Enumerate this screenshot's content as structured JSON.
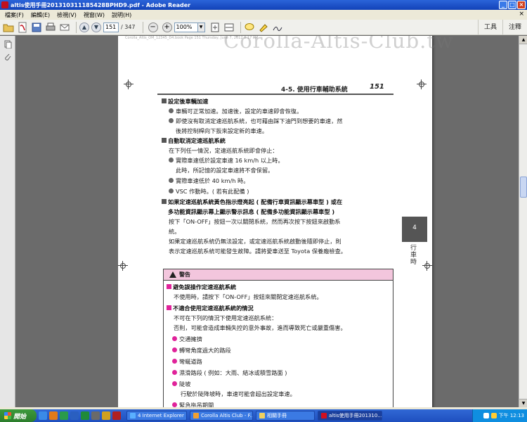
{
  "window": {
    "title": "altis使用手冊201310311185428BPHD9.pdf - Adobe Reader",
    "buttons": [
      "_",
      "□",
      "×"
    ]
  },
  "menu": {
    "items": [
      "檔案(F)",
      "編輯(E)",
      "檢視(V)",
      "視窗(W)",
      "說明(H)"
    ],
    "close": "×"
  },
  "toolbar": {
    "page_current": "151",
    "page_total": "/ 347",
    "zoom": "100%",
    "zoom_out": "−",
    "zoom_in": "+",
    "tools_label": "工具",
    "comment_label": "注釋",
    "prev_arrow": "▲",
    "next_arrow": "▼",
    "dropdown": "▼"
  },
  "scrollbar": {
    "up": "▲",
    "down": "▼"
  },
  "pdf": {
    "watermark": "Corolla-Altis-Club.tw",
    "header_strip": "Corolla_Altis_OM_12345_D4.book  Page 151  Thursday, June 7, 2012  8:17 PM",
    "section_title": "4-5. 使用行車輔助系統",
    "page_number": "151",
    "side_tab_number": "4",
    "side_tab_label": "行車時",
    "s1": {
      "head": "設定後車輛加速",
      "b1": "車輛可正常加速。加速後，設定的車速即會恢復。",
      "b2a": "即使沒有取消定速巡航系統，也可藉由踩下油門到想要的車速，然",
      "b2b": "後將控制桿向下扳來設定新的車速。"
    },
    "s2": {
      "head": "自動取消定速巡航系統",
      "intro": "在下列任一情況，定速巡航系統即會停止：",
      "b1": "實際車速低於設定車速 16 km/h 以上時。",
      "b1b": "此時，所記憶的設定車速將不會保留。",
      "b2": "實際車速低於 40 km/h 時。",
      "b3": "VSC 作動時。( 若有此配備 )"
    },
    "s3": {
      "head1": "如果定速巡航系統黃色指示燈亮起 ( 配備行車資訊顯示幕車型 ) 或在",
      "head2": "多功能資訊顯示幕上顯示警示訊息 ( 配備多功能資訊顯示幕車型 )",
      "p1a": "按下「ON-OFF」按鈕一次以關閉系統，然而再次按下按鈕來啟動系",
      "p1b": "統。",
      "p2a": "如果定速巡航系統仍無法設定，或定速巡航系統啟動後隨即停止，則",
      "p2b": "表示定速巡航系統可能發生故障。請將愛車送至 Toyota 保養廠檢查。"
    },
    "warning": {
      "title": "警告",
      "h1": "避免誤操作定速巡航系統",
      "t1": "不使用時，請按下「ON-OFF」按鈕來關閉定速巡航系統。",
      "h2": "不適合使用定速巡航系統的情況",
      "t2a": "不可在下列的情況下使用定速巡航系統：",
      "t2b": "否則，可能會造成車輛失控的意外事故，進而導致死亡或嚴重傷害。",
      "items": [
        "交通擁擠",
        "轉彎角度過大的路段",
        "彎蜒道路",
        "濕滑路段 ( 例如：大雨、結冰或積雪路面 )",
        "陡坡",
        "緊急拖吊期間"
      ],
      "slope_note": "行駛於陡降坡時，車速可能會超出設定車速。"
    }
  },
  "taskbar": {
    "start": "開始",
    "tasks": [
      "4 Internet Explorer",
      "Corolla Altis Club - F...",
      "相關手冊",
      "altis使用手冊201310..."
    ],
    "clock": "下午 12:13"
  },
  "colors": {
    "titlebar": "#1242b8",
    "warning_header": "#f3c6dd",
    "warning_bullet": "#e0239a",
    "taskbar": "#1f4fbf",
    "start_button": "#2c7d2c"
  }
}
